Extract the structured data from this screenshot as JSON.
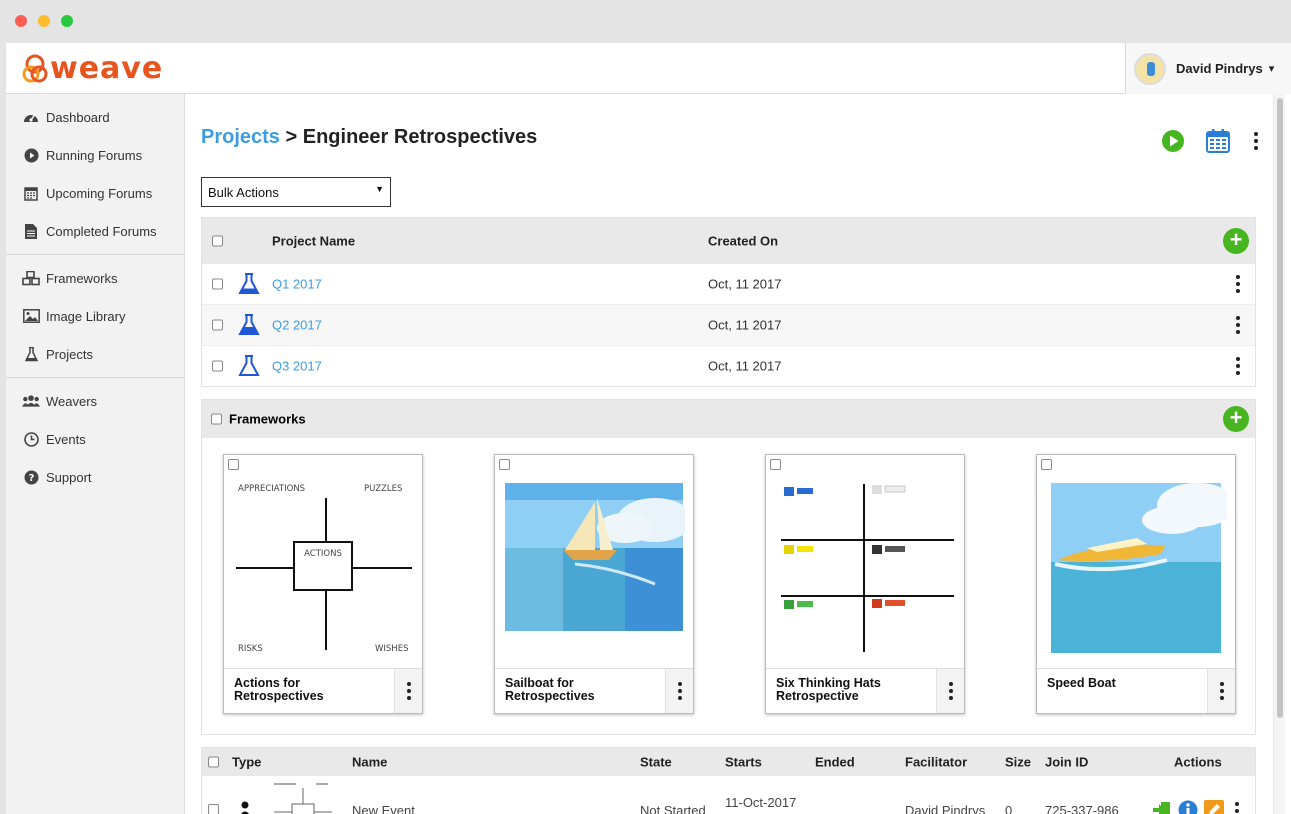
{
  "app": {
    "name": "weave",
    "colors": {
      "brand": "#e8541e",
      "link": "#3a9de1",
      "add": "#47b51f"
    }
  },
  "user": {
    "name": "David Pindrys",
    "caret": "▾"
  },
  "sidebar": {
    "groups": [
      [
        {
          "label": "Dashboard",
          "icon": "dashboard-icon"
        },
        {
          "label": "Running Forums",
          "icon": "play-icon"
        },
        {
          "label": "Upcoming Forums",
          "icon": "calendar-icon"
        },
        {
          "label": "Completed Forums",
          "icon": "document-icon"
        }
      ],
      [
        {
          "label": "Frameworks",
          "icon": "cubes-icon"
        },
        {
          "label": "Image Library",
          "icon": "image-icon"
        },
        {
          "label": "Projects",
          "icon": "flask-icon"
        }
      ],
      [
        {
          "label": "Weavers",
          "icon": "users-icon"
        },
        {
          "label": "Events",
          "icon": "clock-icon"
        },
        {
          "label": "Support",
          "icon": "help-icon"
        }
      ]
    ]
  },
  "header": {
    "crumb": "Projects",
    "sep": ">",
    "title": "Engineer Retrospectives"
  },
  "bulk": {
    "label": "Bulk Actions"
  },
  "projects": {
    "columns": {
      "name": "Project Name",
      "created": "Created On"
    },
    "rows": [
      {
        "name": "Q1 2017",
        "created": "Oct, 11 2017"
      },
      {
        "name": "Q2 2017",
        "created": "Oct, 11 2017"
      },
      {
        "name": "Q3 2017",
        "created": "Oct, 11 2017"
      }
    ]
  },
  "frameworks": {
    "label": "Frameworks",
    "cards": [
      {
        "title": "Actions for Retrospectives",
        "thumb": {
          "appreciations": "APPRECIATIONS",
          "puzzles": "PUZZLES",
          "actions": "ACTIONS",
          "risks": "RISKS",
          "wishes": "WISHES"
        }
      },
      {
        "title": "Sailboat for Retrospectives"
      },
      {
        "title": "Six Thinking Hats Retrospective"
      },
      {
        "title": "Speed Boat"
      }
    ]
  },
  "events": {
    "columns": [
      "Type",
      "Name",
      "State",
      "Starts",
      "Ended",
      "Facilitator",
      "Size",
      "Join ID",
      "Actions"
    ],
    "rows": [
      {
        "name": "New Event",
        "state": "Not Started",
        "starts": "11-Oct-2017",
        "facilitator": "David Pindrys",
        "size": "0",
        "join_id": "725-337-986"
      }
    ]
  }
}
